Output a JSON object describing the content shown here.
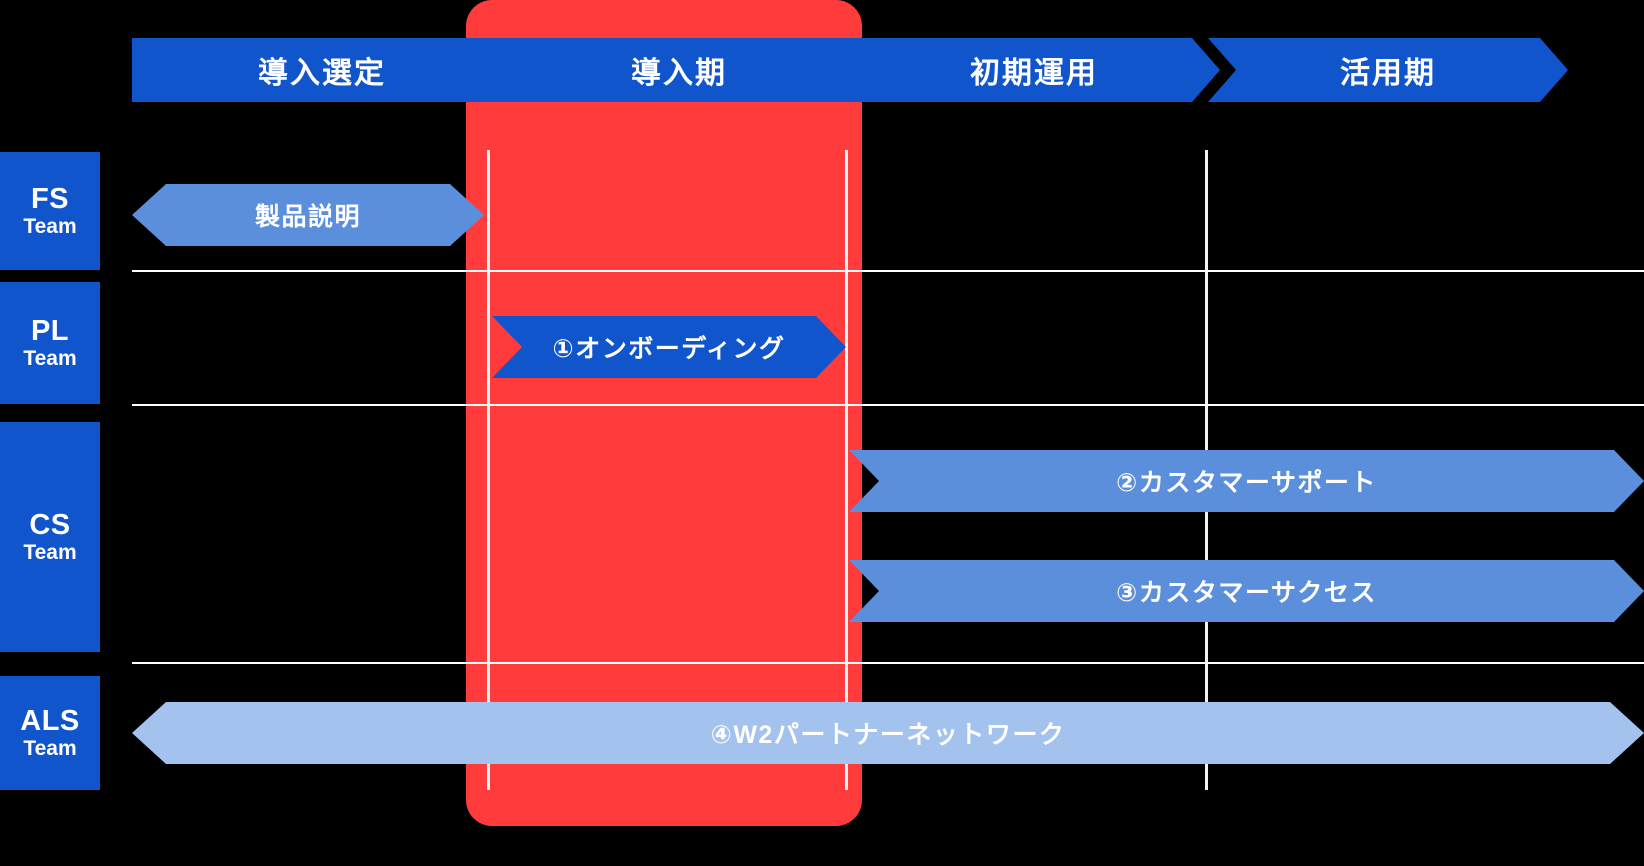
{
  "colors": {
    "background": "#000000",
    "phase_blue": "#1055CC",
    "bar_blue_mid": "#5B8FDB",
    "bar_blue_deep": "#1055CC",
    "bar_blue_light": "#A4C2EE",
    "highlight_red": "#FF3B3B",
    "grid_line": "#FFFFFF",
    "text": "#FFFFFF"
  },
  "phases": [
    {
      "label": "導入選定",
      "shape": "chev-start"
    },
    {
      "label": "導入期",
      "shape": "chev-both",
      "highlighted": true
    },
    {
      "label": "初期運用",
      "shape": "chev-both"
    },
    {
      "label": "活用期",
      "shape": "chev-both"
    }
  ],
  "teams": [
    {
      "code": "FS",
      "sub": "Team"
    },
    {
      "code": "PL",
      "sub": "Team"
    },
    {
      "code": "CS",
      "sub": "Team"
    },
    {
      "code": "ALS",
      "sub": "Team"
    }
  ],
  "bars": [
    {
      "label": "製品説明",
      "team": "FS",
      "shape": "point-both",
      "color": "#5B8FDB"
    },
    {
      "label": "①オンボーディング",
      "team": "PL",
      "shape": "point-left-notch",
      "color": "#1055CC"
    },
    {
      "label": "②カスタマーサポート",
      "team": "CS",
      "shape": "point-left-notch",
      "color": "#5B8FDB"
    },
    {
      "label": "③カスタマーサクセス",
      "team": "CS",
      "shape": "point-left-notch",
      "color": "#5B8FDB"
    },
    {
      "label": "④W2パートナーネットワーク",
      "team": "ALS",
      "shape": "point-both",
      "color": "#A4C2EE"
    }
  ]
}
